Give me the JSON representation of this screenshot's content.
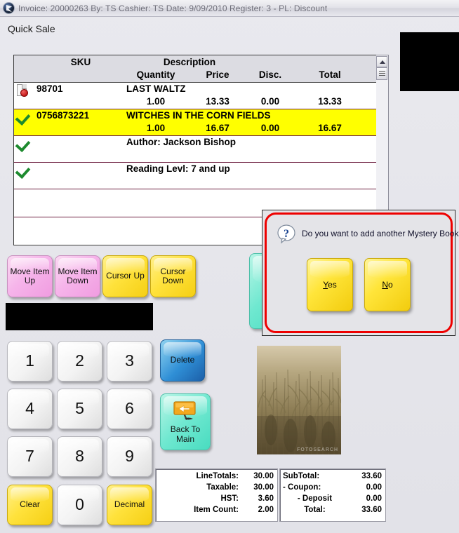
{
  "titlebar": {
    "icon": "app-logo-icon",
    "text": "Invoice: 20000263  By: TS   Cashier: TS    Date:  9/09/2010  Register: 3 - PL: Discount",
    "invoice": "20000263",
    "by": "TS",
    "cashier": "TS",
    "date": "9/09/2010",
    "register": "3",
    "price_level": "Discount"
  },
  "form": {
    "title": "Quick Sale"
  },
  "grid": {
    "headers": {
      "sku": "SKU",
      "description": "Description",
      "quantity": "Quantity",
      "price": "Price",
      "disc": "Disc.",
      "total": "Total"
    },
    "rows": [
      {
        "icon": "document-error-icon",
        "sku": "98701",
        "description": "LAST WALTZ",
        "quantity": "1.00",
        "price": "13.33",
        "disc": "0.00",
        "total": "13.33",
        "highlighted": false
      },
      {
        "icon": "green-check-icon",
        "sku": "0756873221",
        "description": "WITCHES IN THE CORN FIELDS",
        "quantity": "1.00",
        "price": "16.67",
        "disc": "0.00",
        "total": "16.67",
        "highlighted": true
      }
    ],
    "detail_rows": [
      {
        "icon": "green-check-icon",
        "text": "Author: Jackson Bishop"
      },
      {
        "icon": "green-check-icon",
        "text": "Reading Levl: 7 and up"
      }
    ],
    "scrollbar": {
      "up_arrow": "scroll-up-icon"
    }
  },
  "action_buttons": [
    {
      "label": "Move Item\nUp",
      "color": "pink"
    },
    {
      "label": "Move Item\nDown",
      "color": "pink"
    },
    {
      "label": "Cursor Up",
      "color": "yellow"
    },
    {
      "label": "Cursor\nDown",
      "color": "yellow"
    }
  ],
  "display_field": {
    "value": ""
  },
  "keypad": {
    "keys": [
      "1",
      "2",
      "3",
      "4",
      "5",
      "6",
      "7",
      "8",
      "9"
    ],
    "clear": "Clear",
    "zero": "0",
    "decimal": "Decimal"
  },
  "side_buttons": {
    "delete": "Delete",
    "back_to_main": "Back To\nMain",
    "back_to_main_icon": "back-arrow-sign-icon"
  },
  "cover_image": {
    "alt": "corn-field-book-cover",
    "watermark": "FOTOSEARCH"
  },
  "totals_left": [
    {
      "label": "LineTotals:",
      "value": "30.00"
    },
    {
      "label": "Taxable:",
      "value": "30.00"
    },
    {
      "label": "HST:",
      "value": "3.60"
    },
    {
      "label": "Item Count:",
      "value": "2.00"
    }
  ],
  "totals_right": [
    {
      "label": "SubTotal:",
      "value": "33.60"
    },
    {
      "label": "- Coupon:",
      "value": "0.00"
    },
    {
      "label": "- Deposit",
      "value": "0.00"
    },
    {
      "label": "Total:",
      "value": "33.60"
    }
  ],
  "dialog": {
    "icon": "question-mark-icon",
    "message": "Do you want to add another Mystery Books?",
    "yes": {
      "key": "Y",
      "rest": "es"
    },
    "no": {
      "key": "N",
      "rest": "o"
    },
    "border_color": "#ee0000"
  },
  "colors": {
    "highlight_row": "#ffff00",
    "row_border": "#6e2040",
    "pink_button": "#f6b4ea",
    "yellow_button": "#ffe23c",
    "blue_button": "#2f8fd6",
    "teal_button": "#6fe8d0",
    "dialog_border": "#ee0000"
  }
}
